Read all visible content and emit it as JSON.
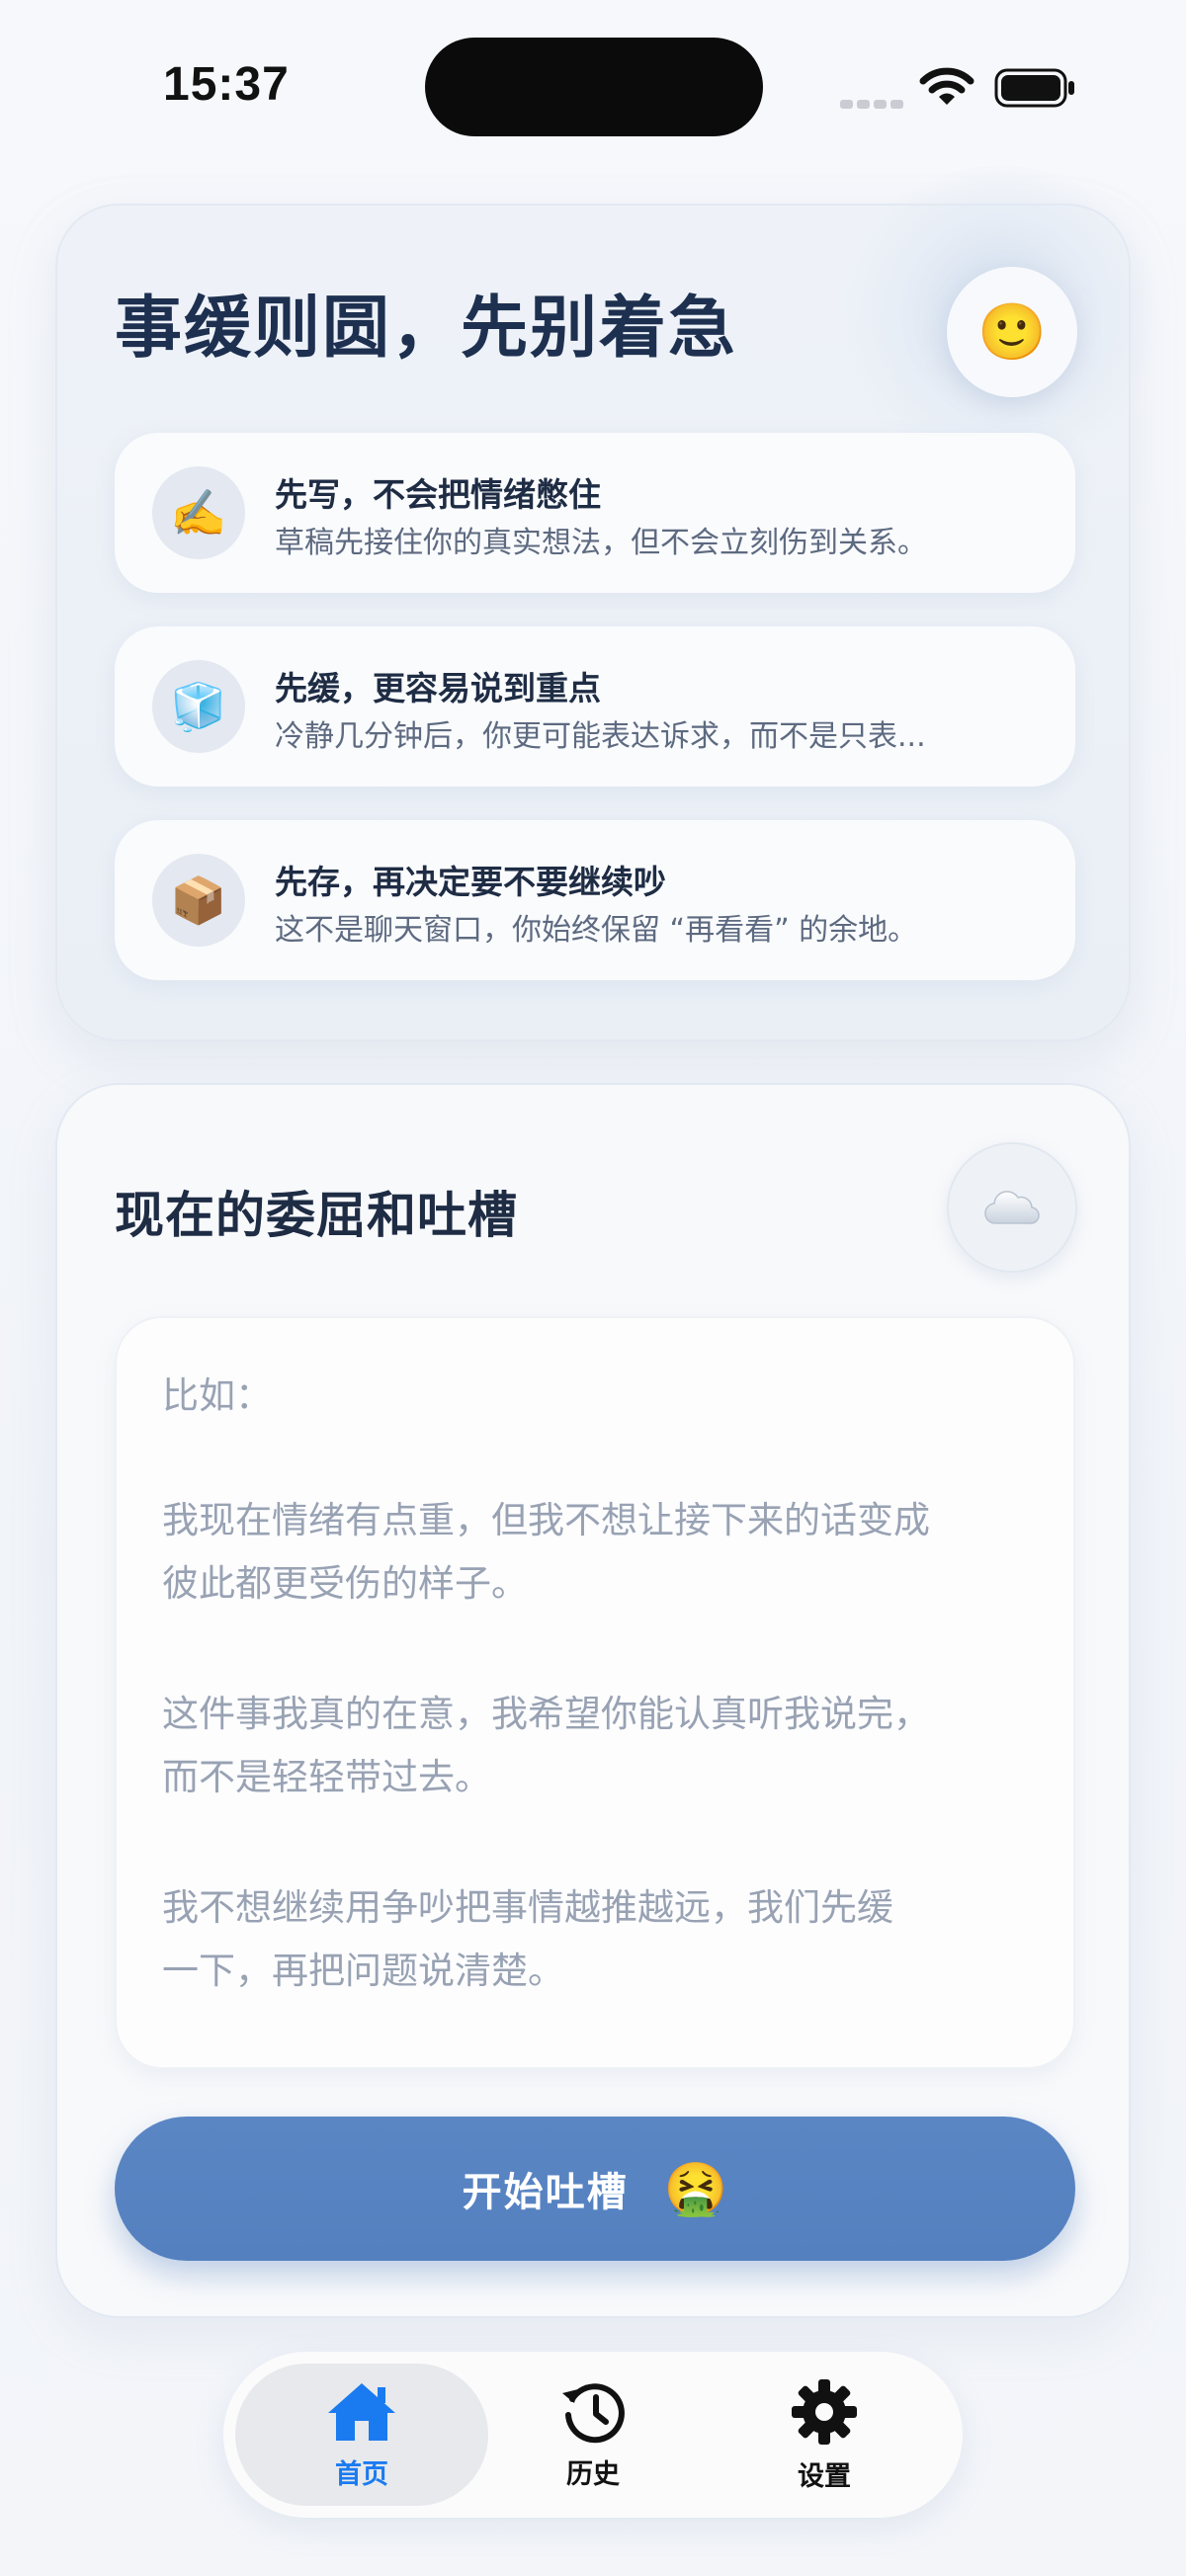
{
  "status_bar": {
    "time": "15:37"
  },
  "hero": {
    "title": "事缓则圆，先别着急",
    "emoji": "🙂",
    "tips": [
      {
        "icon": "✍️",
        "title": "先写，不会把情绪憋住",
        "desc": "草稿先接住你的真实想法，但不会立刻伤到关系。"
      },
      {
        "icon": "🧊",
        "title": "先缓，更容易说到重点",
        "desc": "冷静几分钟后，你更可能表达诉求，而不是只表..."
      },
      {
        "icon": "📦",
        "title": "先存，再决定要不要继续吵",
        "desc": "这不是聊天窗口，你始终保留 “再看看” 的余地。"
      }
    ]
  },
  "compose": {
    "title": "现在的委屈和吐槽",
    "placeholder_lines": [
      "比如：",
      "我现在情绪有点重，但我不想让接下来的话变成",
      "彼此都更受伤的样子。",
      "这件事我真的在意，我希望你能认真听我说完，",
      "而不是轻轻带过去。",
      "我不想继续用争吵把事情越推越远，我们先缓",
      "一下，再把问题说清楚。"
    ],
    "start_label": "开始吐槽",
    "start_emoji": "🤮"
  },
  "tabbar": {
    "tabs": [
      {
        "label": "首页",
        "icon": "home-icon",
        "active": true
      },
      {
        "label": "历史",
        "icon": "history-icon",
        "active": false
      },
      {
        "label": "设置",
        "icon": "gear-icon",
        "active": false
      }
    ]
  },
  "colors": {
    "accent": "#5480bf",
    "tab_active": "#1a7bf0"
  }
}
